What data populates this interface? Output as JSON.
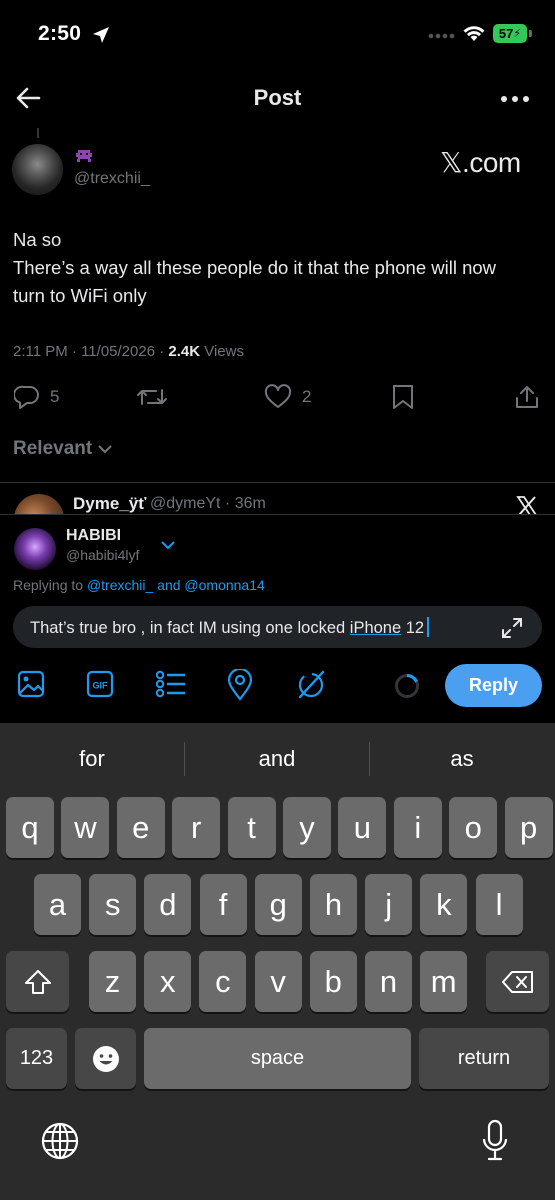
{
  "status_bar": {
    "time": "2:50",
    "battery": "57"
  },
  "header": {
    "title": "Post"
  },
  "post": {
    "author_handle": "@trexchii_",
    "source": "𝕏.com",
    "text": "Na so\nThere’s a way all these people do it that the phone will now turn to WiFi only",
    "time_date": "2:11 PM · 11/05/2026 · ",
    "views_count": "2.4K",
    "views_label": " Views",
    "replies": "5",
    "likes": "2"
  },
  "sort": {
    "label": "Relevant"
  },
  "reply_peek": {
    "name": "Dyme_ÿť",
    "meta": "@dymeYt · 36m"
  },
  "composer": {
    "name": "HABIBI",
    "handle": "@habibi4lyf",
    "replying_prefix": "Replying to ",
    "replying_users": "@trexchii_ and @omonna14",
    "text_before": "That’s true bro , in fact IM using one locked ",
    "text_underlined": "iPhone",
    "text_after": " 12",
    "reply_button": "Reply"
  },
  "keyboard": {
    "suggestions": [
      "for",
      "and",
      "as"
    ],
    "row1": [
      "q",
      "w",
      "e",
      "r",
      "t",
      "y",
      "u",
      "i",
      "o",
      "p"
    ],
    "row2": [
      "a",
      "s",
      "d",
      "f",
      "g",
      "h",
      "j",
      "k",
      "l"
    ],
    "row3": [
      "z",
      "x",
      "c",
      "v",
      "b",
      "n",
      "m"
    ],
    "numbers_key": "123",
    "space_key": "space",
    "return_key": "return"
  }
}
